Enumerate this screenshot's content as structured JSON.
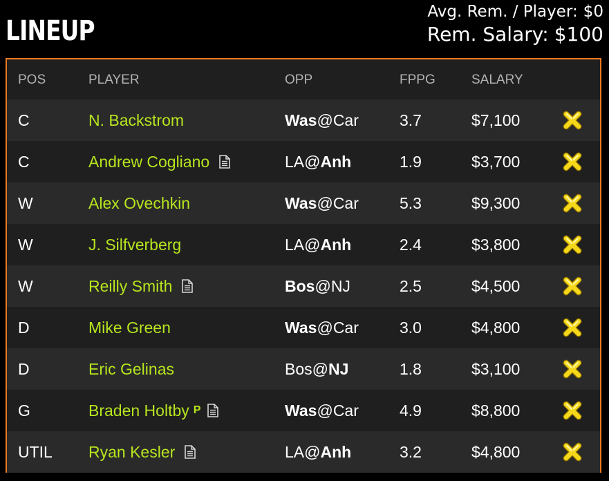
{
  "header": {
    "title": "LINEUP",
    "avg_label": "Avg. Rem. / Player:",
    "avg_value": "$0",
    "rem_label": "Rem. Salary:",
    "rem_value": "$100"
  },
  "table": {
    "columns": [
      "POS",
      "PLAYER",
      "OPP",
      "FPPG",
      "SALARY"
    ],
    "rows": [
      {
        "pos": "C",
        "player": "N. Backstrom",
        "opp_away": "Was",
        "opp_home": "Car",
        "bold": "away",
        "fppg": "3.7",
        "salary": "$7,100",
        "doc": false,
        "probable": false
      },
      {
        "pos": "C",
        "player": "Andrew Cogliano",
        "opp_away": "LA",
        "opp_home": "Anh",
        "bold": "home",
        "fppg": "1.9",
        "salary": "$3,700",
        "doc": true,
        "probable": false
      },
      {
        "pos": "W",
        "player": "Alex Ovechkin",
        "opp_away": "Was",
        "opp_home": "Car",
        "bold": "away",
        "fppg": "5.3",
        "salary": "$9,300",
        "doc": false,
        "probable": false
      },
      {
        "pos": "W",
        "player": "J. Silfverberg",
        "opp_away": "LA",
        "opp_home": "Anh",
        "bold": "home",
        "fppg": "2.4",
        "salary": "$3,800",
        "doc": false,
        "probable": false
      },
      {
        "pos": "W",
        "player": "Reilly Smith",
        "opp_away": "Bos",
        "opp_home": "NJ",
        "bold": "away",
        "fppg": "2.5",
        "salary": "$4,500",
        "doc": true,
        "probable": false
      },
      {
        "pos": "D",
        "player": "Mike Green",
        "opp_away": "Was",
        "opp_home": "Car",
        "bold": "away",
        "fppg": "3.0",
        "salary": "$4,800",
        "doc": false,
        "probable": false
      },
      {
        "pos": "D",
        "player": "Eric Gelinas",
        "opp_away": "Bos",
        "opp_home": "NJ",
        "bold": "home",
        "fppg": "1.8",
        "salary": "$3,100",
        "doc": false,
        "probable": false
      },
      {
        "pos": "G",
        "player": "Braden Holtby",
        "opp_away": "Was",
        "opp_home": "Car",
        "bold": "away",
        "fppg": "4.9",
        "salary": "$8,800",
        "doc": true,
        "probable": true
      },
      {
        "pos": "UTIL",
        "player": "Ryan Kesler",
        "opp_away": "LA",
        "opp_home": "Anh",
        "bold": "home",
        "fppg": "3.2",
        "salary": "$4,800",
        "doc": true,
        "probable": false
      }
    ],
    "probable_badge": "P",
    "at_sign": "@"
  },
  "colors": {
    "accent_border": "#f07a1e",
    "player_name": "#b7e61e",
    "row_dark": "#1f1f1f",
    "row_light": "#2a2a2a",
    "remove_icon": "#f5d81a"
  },
  "icons": {
    "remove": "remove-x-icon",
    "note": "document-icon"
  }
}
